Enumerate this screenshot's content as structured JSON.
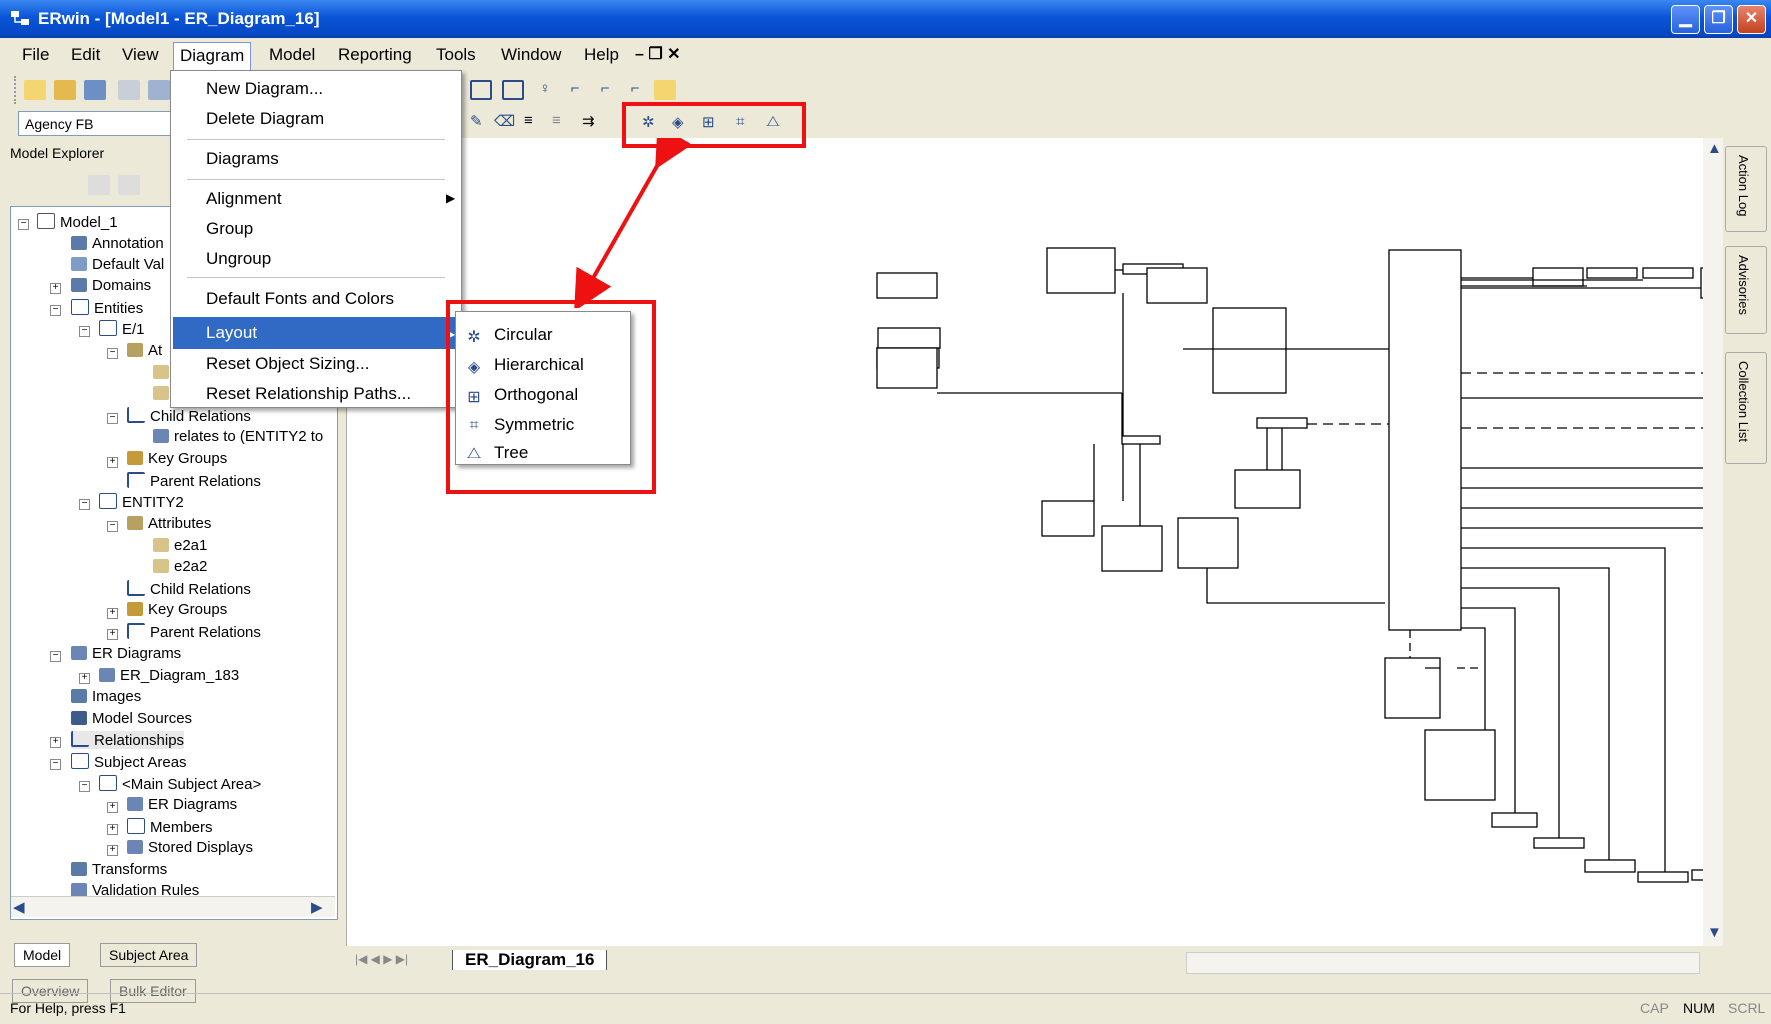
{
  "window": {
    "title": "ERwin - [Model1 - ER_Diagram_16]"
  },
  "menubar": {
    "items": [
      "File",
      "Edit",
      "View",
      "Diagram",
      "Model",
      "Reporting",
      "Tools",
      "Window",
      "Help"
    ]
  },
  "toolbar": {
    "font_name": "Agency FB"
  },
  "explorer": {
    "title": "Model Explorer",
    "tree": [
      "Model_1",
      "Annotation",
      "Default Val",
      "Domains",
      "Entities",
      "E/1",
      "At",
      "",
      "",
      "Child Relations",
      "relates to (ENTITY2 to",
      "Key Groups",
      "Parent Relations",
      "ENTITY2",
      "Attributes",
      "e2a1",
      "e2a2",
      "Child Relations",
      "Key Groups",
      "Parent Relations",
      "ER Diagrams",
      "ER_Diagram_183",
      "Images",
      "Model Sources",
      "Relationships",
      "Subject Areas",
      "<Main Subject Area>",
      "ER Diagrams",
      "Members",
      "Stored Displays",
      "Transforms",
      "Validation Rules"
    ],
    "bottom_tabs": [
      "Model",
      "Subject Area"
    ],
    "lower_tabs": [
      "Overview",
      "Bulk Editor"
    ]
  },
  "diagram_menu": {
    "items": [
      "New Diagram...",
      "Delete Diagram",
      "Diagrams",
      "Alignment",
      "Group",
      "Ungroup",
      "Default Fonts and Colors",
      "Layout",
      "Reset Object Sizing...",
      "Reset Relationship Paths..."
    ]
  },
  "layout_submenu": {
    "items": [
      "Circular",
      "Hierarchical",
      "Orthogonal",
      "Symmetric",
      "Tree"
    ]
  },
  "side_tabs": [
    "Action Log",
    "Advisories",
    "Collection List"
  ],
  "diagram_tab": "ER_Diagram_16",
  "status": {
    "help": "For Help, press F1",
    "indicators": [
      "CAP",
      "NUM",
      "SCRL"
    ]
  },
  "colors": {
    "title_bar": "#0a55d8",
    "highlight": "#316ac5",
    "annotation": "#ee1111"
  },
  "icons": [
    "app-icon",
    "minimize-icon",
    "restore-icon",
    "close-icon",
    "circular-layout-icon",
    "hierarchical-layout-icon",
    "orthogonal-layout-icon",
    "symmetric-layout-icon",
    "tree-layout-icon"
  ]
}
